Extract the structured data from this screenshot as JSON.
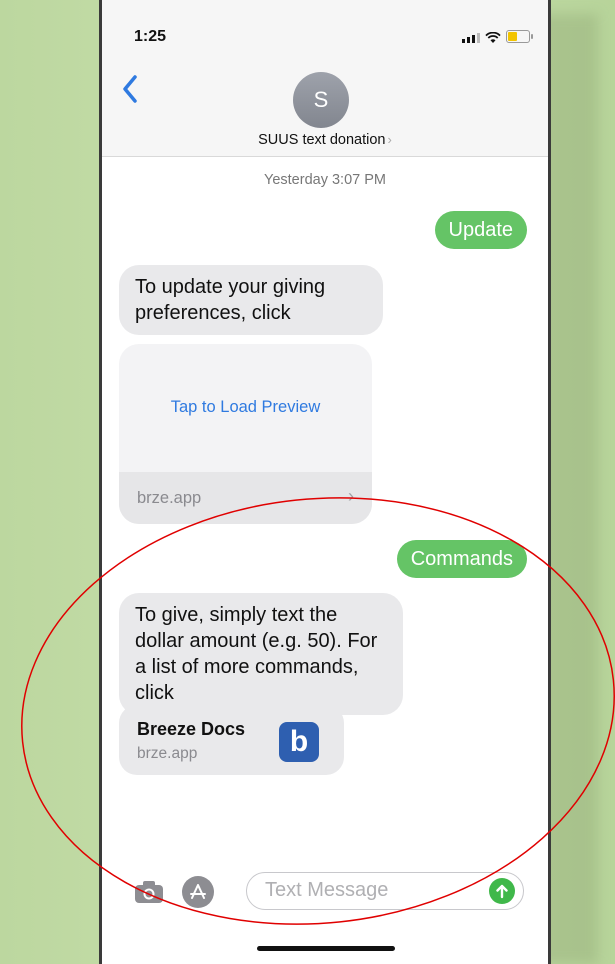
{
  "status_bar": {
    "time": "1:25"
  },
  "header": {
    "avatar_initial": "S",
    "contact_name": "SUUS text donation"
  },
  "conversation": {
    "timestamp": "Yesterday 3:07 PM",
    "sent_update": "Update",
    "reply_update": "To update your giving preferences, click",
    "link_preview": {
      "action_text": "Tap to Load Preview",
      "domain": "brze.app"
    },
    "sent_commands": "Commands",
    "reply_commands": "To give, simply text the dollar amount (e.g. 50). For a list of more commands, click",
    "docs_link": {
      "title": "Breeze Docs",
      "domain": "brze.app",
      "icon_letter": "b"
    }
  },
  "input": {
    "placeholder": "Text Message"
  },
  "colors": {
    "sent_bubble": "#65c466",
    "received_bubble": "#e9e9eb",
    "link_blue": "#2f7ae0",
    "annotation_red": "#e00000",
    "background_green": "#c4dca8"
  },
  "icons": [
    "back-chevron-icon",
    "signal-icon",
    "wifi-icon",
    "battery-icon",
    "camera-icon",
    "app-store-icon",
    "send-arrow-icon",
    "breeze-app-icon"
  ]
}
